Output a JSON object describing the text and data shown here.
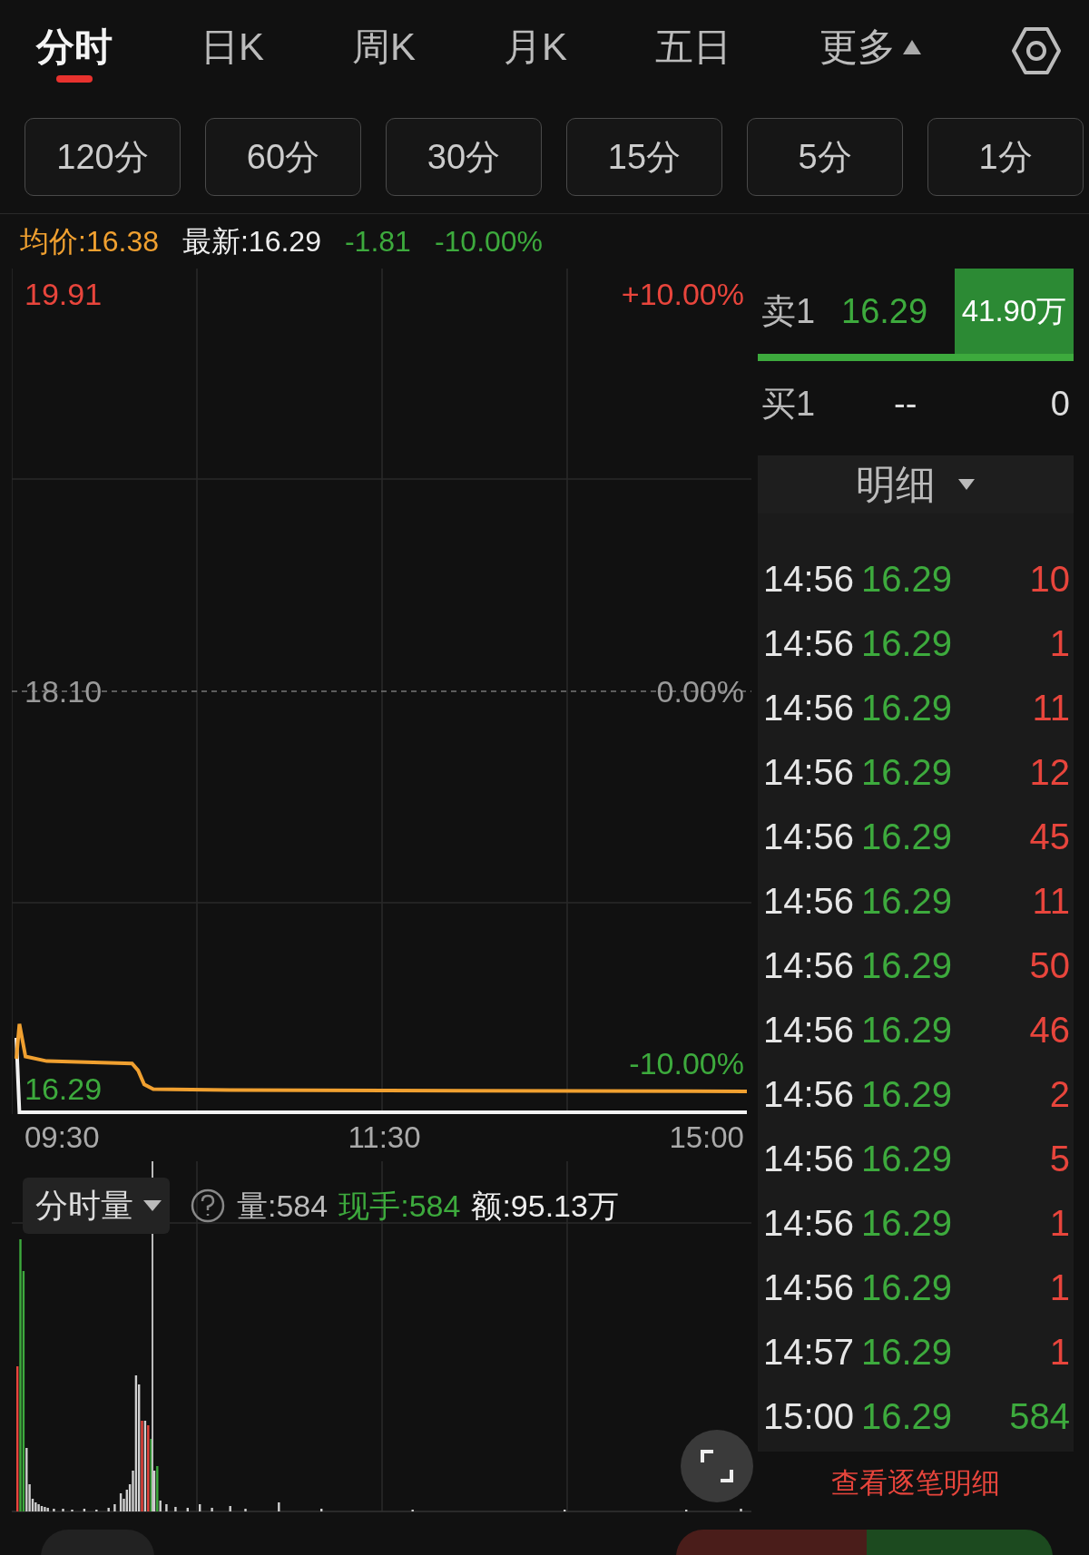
{
  "tabs": [
    {
      "label": "分时",
      "selected": true,
      "kind": "tab"
    },
    {
      "label": "日K",
      "selected": false,
      "kind": "tab"
    },
    {
      "label": "周K",
      "selected": false,
      "kind": "tab"
    },
    {
      "label": "月K",
      "selected": false,
      "kind": "tab"
    },
    {
      "label": "五日",
      "selected": false,
      "kind": "tab"
    },
    {
      "label": "更多",
      "selected": false,
      "kind": "menu"
    }
  ],
  "intervals": [
    "120分",
    "60分",
    "30分",
    "15分",
    "5分",
    "1分"
  ],
  "quote": {
    "average": "均价:16.38",
    "latest": "最新:16.29",
    "change": "-1.81",
    "change_pct": "-10.00%"
  },
  "price_chart": {
    "left_labels": [
      "19.91",
      "18.10",
      "16.29"
    ],
    "right_labels": [
      "+10.00%",
      "0.00%",
      "-10.00%"
    ],
    "time_labels": [
      "09:30",
      "11:30",
      "15:00"
    ]
  },
  "volume": {
    "selector": "分时量",
    "volume": "量:584",
    "current_hand": "现手:584",
    "amount": "额:95.13万"
  },
  "order_book": {
    "sell": {
      "label": "卖1",
      "price": "16.29",
      "volume": "41.90万",
      "level": 1
    },
    "buy": {
      "label": "买1",
      "price": "--",
      "volume": "0"
    }
  },
  "details": {
    "title": "明细",
    "rows": [
      {
        "time": "14:56",
        "price": "16.29",
        "volume": "10",
        "color": "#e8453c"
      },
      {
        "time": "14:56",
        "price": "16.29",
        "volume": "1",
        "color": "#e8453c"
      },
      {
        "time": "14:56",
        "price": "16.29",
        "volume": "11",
        "color": "#e8453c"
      },
      {
        "time": "14:56",
        "price": "16.29",
        "volume": "12",
        "color": "#e8453c"
      },
      {
        "time": "14:56",
        "price": "16.29",
        "volume": "45",
        "color": "#e8453c"
      },
      {
        "time": "14:56",
        "price": "16.29",
        "volume": "11",
        "color": "#e8453c"
      },
      {
        "time": "14:56",
        "price": "16.29",
        "volume": "50",
        "color": "#e8453c"
      },
      {
        "time": "14:56",
        "price": "16.29",
        "volume": "46",
        "color": "#e8453c"
      },
      {
        "time": "14:56",
        "price": "16.29",
        "volume": "2",
        "color": "#e8453c"
      },
      {
        "time": "14:56",
        "price": "16.29",
        "volume": "5",
        "color": "#e8453c"
      },
      {
        "time": "14:56",
        "price": "16.29",
        "volume": "1",
        "color": "#e8453c"
      },
      {
        "time": "14:56",
        "price": "16.29",
        "volume": "1",
        "color": "#e8453c"
      },
      {
        "time": "14:57",
        "price": "16.29",
        "volume": "1",
        "color": "#e8453c"
      },
      {
        "time": "15:00",
        "price": "16.29",
        "volume": "584",
        "color": "#3daa3d"
      }
    ],
    "link": "查看逐笔明细"
  }
}
